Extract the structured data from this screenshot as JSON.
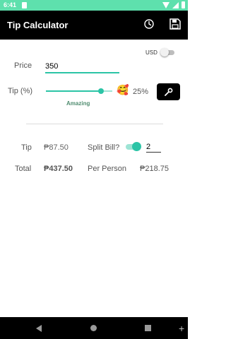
{
  "status_bar": {
    "time": "6:41",
    "icons": [
      "sd-card-icon",
      "wifi-icon",
      "signal-icon",
      "battery-icon"
    ]
  },
  "app_bar": {
    "title": "Tip Calculator",
    "actions": [
      "history-icon",
      "save-icon"
    ]
  },
  "currency": {
    "label": "USD",
    "usd_enabled": false
  },
  "price": {
    "label": "Price",
    "value": "350"
  },
  "tip": {
    "label": "Tip (%)",
    "percent_text": "25%",
    "slider_fraction": 0.83,
    "emoji": "🥰",
    "rating": "Amazing"
  },
  "results": {
    "tip_label": "Tip",
    "tip_value": "₱87.50",
    "split_label": "Split Bill?",
    "split_enabled": true,
    "split_count": "2",
    "total_label": "Total",
    "total_value": "₱437.50",
    "per_person_label": "Per Person",
    "per_person_value": "₱218.75"
  },
  "colors": {
    "accent": "#2bc4a6",
    "status_bar": "#5ee0ad",
    "app_bar": "#000000",
    "rating_text": "#4f8c6f"
  }
}
